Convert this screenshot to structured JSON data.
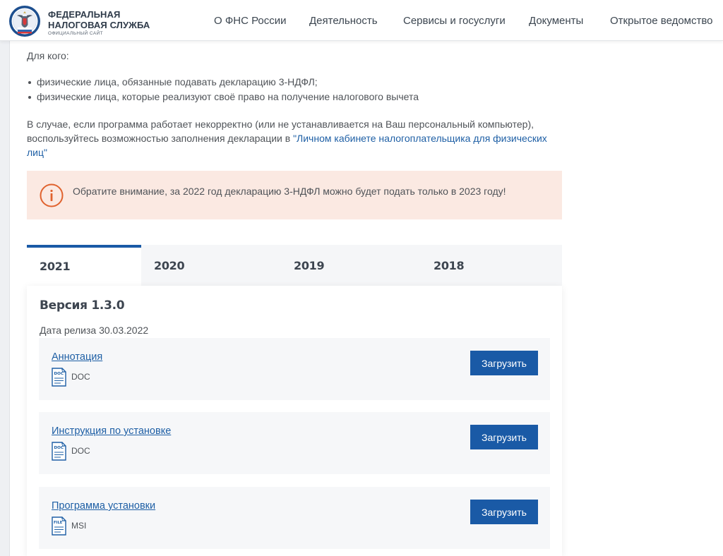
{
  "header": {
    "brand_line1": "ФЕДЕРАЛЬНАЯ",
    "brand_line2": "НАЛОГОВАЯ СЛУЖБА",
    "brand_sub": "ОФИЦИАЛЬНЫЙ САЙТ",
    "nav": [
      "О ФНС России",
      "Деятельность",
      "Сервисы и госуслуги",
      "Документы",
      "Открытое ведомство"
    ]
  },
  "intro": {
    "for_whom": "Для кого:",
    "audience": [
      "физические лица, обязанные подавать декларацию 3-НДФЛ;",
      "физические лица, которые реализуют своё право на получение налогового вычета"
    ],
    "note_before": "В случае, если программа работает некорректно (или не устанавливается на Ваш персональный компьютер), воспользуйтесь возможностью заполнения декларации в ",
    "note_link": "\"Личном кабинете налогоплательщика для физических лиц\""
  },
  "alert": {
    "text": "Обратите внимание, за 2022 год декларацию 3-НДФЛ можно будет подать только в 2023 году!"
  },
  "tabs": {
    "items": [
      "2021",
      "2020",
      "2019",
      "2018"
    ],
    "active": "2021"
  },
  "panel": {
    "version_title": "Версия 1.3.0",
    "release_date": "Дата релиза 30.03.2022",
    "files": [
      {
        "title": "Аннотация",
        "icon_label": "DOC",
        "format": "DOC",
        "button": "Загрузить"
      },
      {
        "title": "Инструкция по установке",
        "icon_label": "DOC",
        "format": "DOC",
        "button": "Загрузить"
      },
      {
        "title": "Программа установки",
        "icon_label": "FILE",
        "format": "MSI",
        "button": "Загрузить"
      }
    ]
  },
  "colors": {
    "accent": "#1a5aa6",
    "link": "#1e5fa5",
    "alert_bg": "#fbe9e2",
    "alert_icon": "#e0622e"
  }
}
